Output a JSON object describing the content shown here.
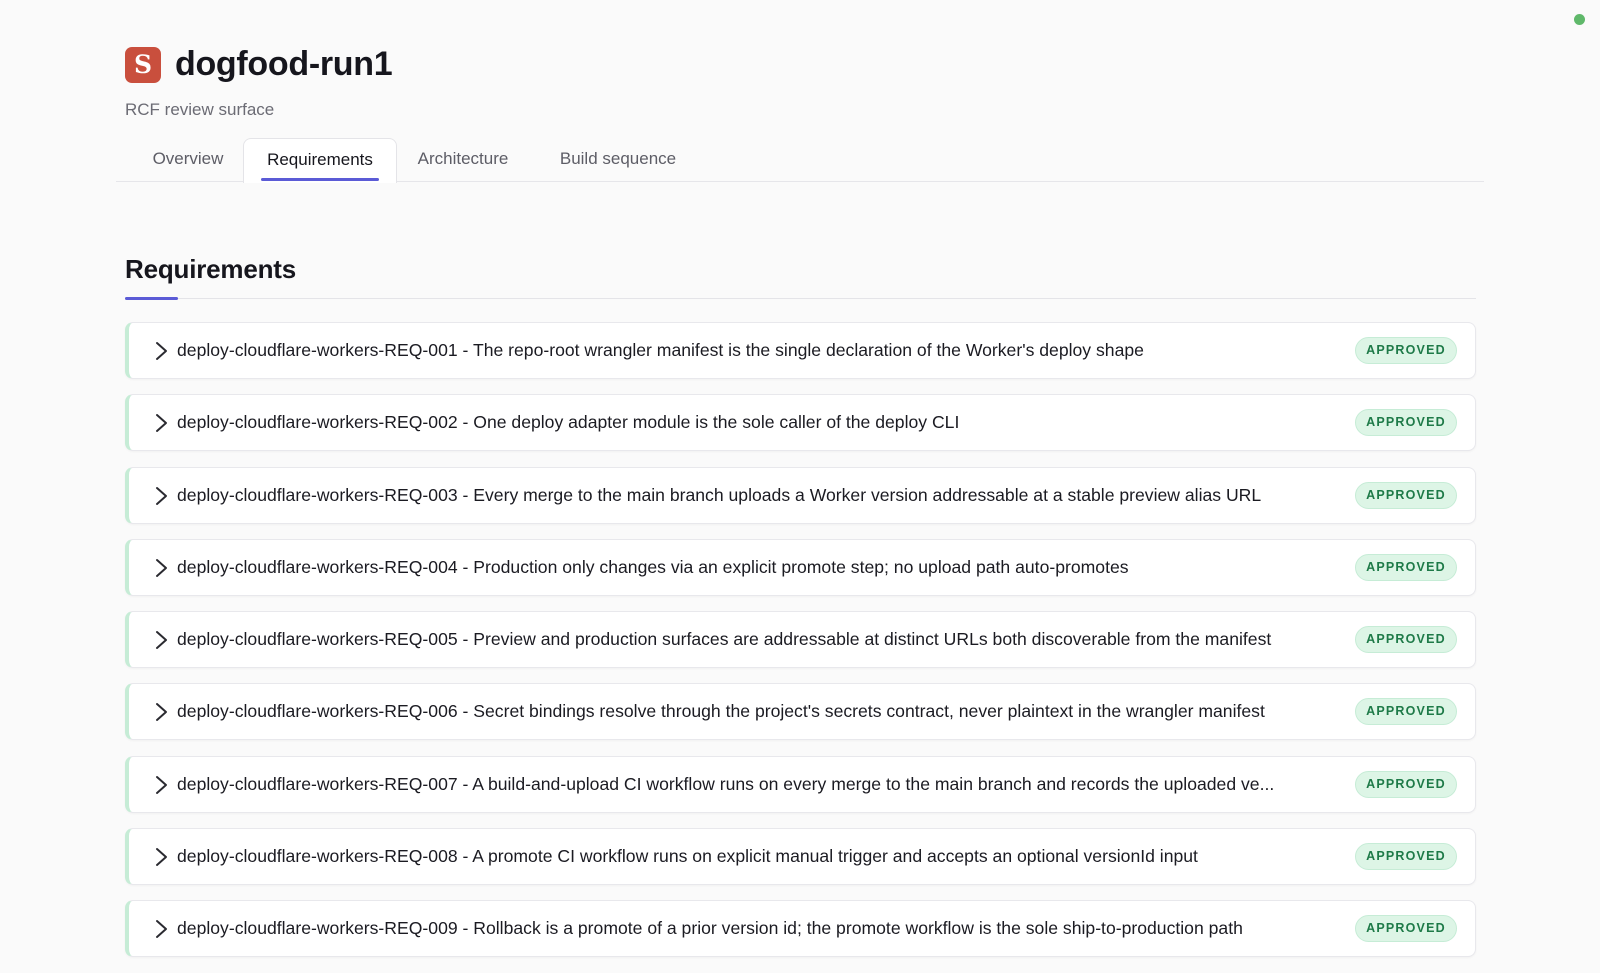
{
  "app": {
    "title": "dogfood-run1",
    "subtitle": "RCF review surface",
    "logo_letter": "S",
    "accent_color": "#5b5bd6",
    "logo_color": "#c94f3d"
  },
  "tabs": [
    {
      "label": "Overview",
      "active": false
    },
    {
      "label": "Requirements",
      "active": true
    },
    {
      "label": "Architecture",
      "active": false
    },
    {
      "label": "Build sequence",
      "active": false
    }
  ],
  "section": {
    "title": "Requirements"
  },
  "requirements": [
    {
      "text": "deploy-cloudflare-workers-REQ-001 - The repo-root wrangler manifest is the single declaration of the Worker's deploy shape",
      "status": "APPROVED"
    },
    {
      "text": "deploy-cloudflare-workers-REQ-002 - One deploy adapter module is the sole caller of the deploy CLI",
      "status": "APPROVED"
    },
    {
      "text": "deploy-cloudflare-workers-REQ-003 - Every merge to the main branch uploads a Worker version addressable at a stable preview alias URL",
      "status": "APPROVED"
    },
    {
      "text": "deploy-cloudflare-workers-REQ-004 - Production only changes via an explicit promote step; no upload path auto-promotes",
      "status": "APPROVED"
    },
    {
      "text": "deploy-cloudflare-workers-REQ-005 - Preview and production surfaces are addressable at distinct URLs both discoverable from the manifest",
      "status": "APPROVED"
    },
    {
      "text": "deploy-cloudflare-workers-REQ-006 - Secret bindings resolve through the project's secrets contract, never plaintext in the wrangler manifest",
      "status": "APPROVED"
    },
    {
      "text": "deploy-cloudflare-workers-REQ-007 - A build-and-upload CI workflow runs on every merge to the main branch and records the uploaded ve...",
      "status": "APPROVED"
    },
    {
      "text": "deploy-cloudflare-workers-REQ-008 - A promote CI workflow runs on explicit manual trigger and accepts an optional versionId input",
      "status": "APPROVED"
    },
    {
      "text": "deploy-cloudflare-workers-REQ-009 - Rollback is a promote of a prior version id; the promote workflow is the sole ship-to-production path",
      "status": "APPROVED"
    }
  ],
  "status_colors": {
    "approved_bg": "#ddf5e6",
    "approved_text": "#1e7a48",
    "connection_dot": "#5fb86a"
  },
  "icons": {
    "row_expand": "chevron-right-icon"
  }
}
